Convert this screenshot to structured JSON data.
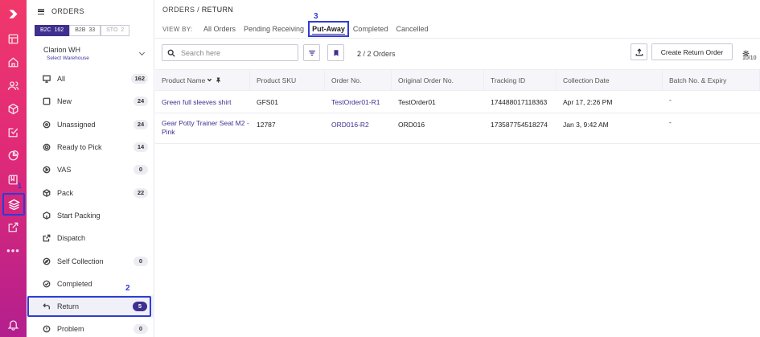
{
  "annotations": {
    "m1": "1",
    "m2": "2",
    "m3": "3"
  },
  "sidebar": {
    "title": "ORDERS",
    "chips": [
      {
        "label": "B2C",
        "count": "162"
      },
      {
        "label": "B2B",
        "count": "33"
      },
      {
        "label": "STO",
        "count": "2"
      }
    ],
    "warehouse": {
      "name": "Clarion WH",
      "sub": "Select Warehouse"
    },
    "items": [
      {
        "label": "All",
        "count": "162",
        "icon": "monitor-icon"
      },
      {
        "label": "New",
        "count": "24",
        "icon": "square-icon"
      },
      {
        "label": "Unassigned",
        "count": "24",
        "icon": "circle-icon"
      },
      {
        "label": "Ready to Pick",
        "count": "14",
        "icon": "target-icon"
      },
      {
        "label": "VAS",
        "count": "0",
        "icon": "play-circle-icon"
      },
      {
        "label": "Pack",
        "count": "22",
        "icon": "box-icon"
      },
      {
        "label": "Start Packing",
        "count": "",
        "icon": "package-icon"
      },
      {
        "label": "Dispatch",
        "count": "",
        "icon": "external-link-icon"
      },
      {
        "label": "Self Collection",
        "count": "0",
        "icon": "compass-icon"
      },
      {
        "label": "Completed",
        "count": "",
        "icon": "check-circle-icon"
      },
      {
        "label": "Return",
        "count": "5",
        "icon": "return-arrow-icon"
      },
      {
        "label": "Problem",
        "count": "0",
        "icon": "alert-circle-icon"
      }
    ]
  },
  "header": {
    "breadcrumb_root": "ORDERS",
    "breadcrumb_sep": "/",
    "breadcrumb_current": "RETURN",
    "view_by": "VIEW BY:",
    "tabs": [
      "All Orders",
      "Pending Receiving",
      "Put-Away",
      "Completed",
      "Cancelled"
    ]
  },
  "toolbar": {
    "search_placeholder": "Search here",
    "count_shown": "2",
    "count_total": "2 Orders",
    "create_label": "Create Return Order",
    "columns_count": "10/10"
  },
  "table": {
    "columns": [
      "Product Name",
      "Product SKU",
      "Order No.",
      "Original Order No.",
      "Tracking ID",
      "Collection Date",
      "Batch No. & Expiry"
    ],
    "rows": [
      [
        "Green full sleeves shirt",
        "GFS01",
        "TestOrder01-R1",
        "TestOrder01",
        "174488017118363",
        "Apr 17, 2:26 PM",
        "-"
      ],
      [
        "Gear Potty Trainer Seat M2 - Pink",
        "12787",
        "ORD016-R2",
        "ORD016",
        "173587754518274",
        "Jan 3, 9:42 AM",
        "-"
      ]
    ]
  },
  "colors": {
    "brand": "#e8326f",
    "accent": "#3f2f8f",
    "highlight": "#2f3bd6"
  }
}
